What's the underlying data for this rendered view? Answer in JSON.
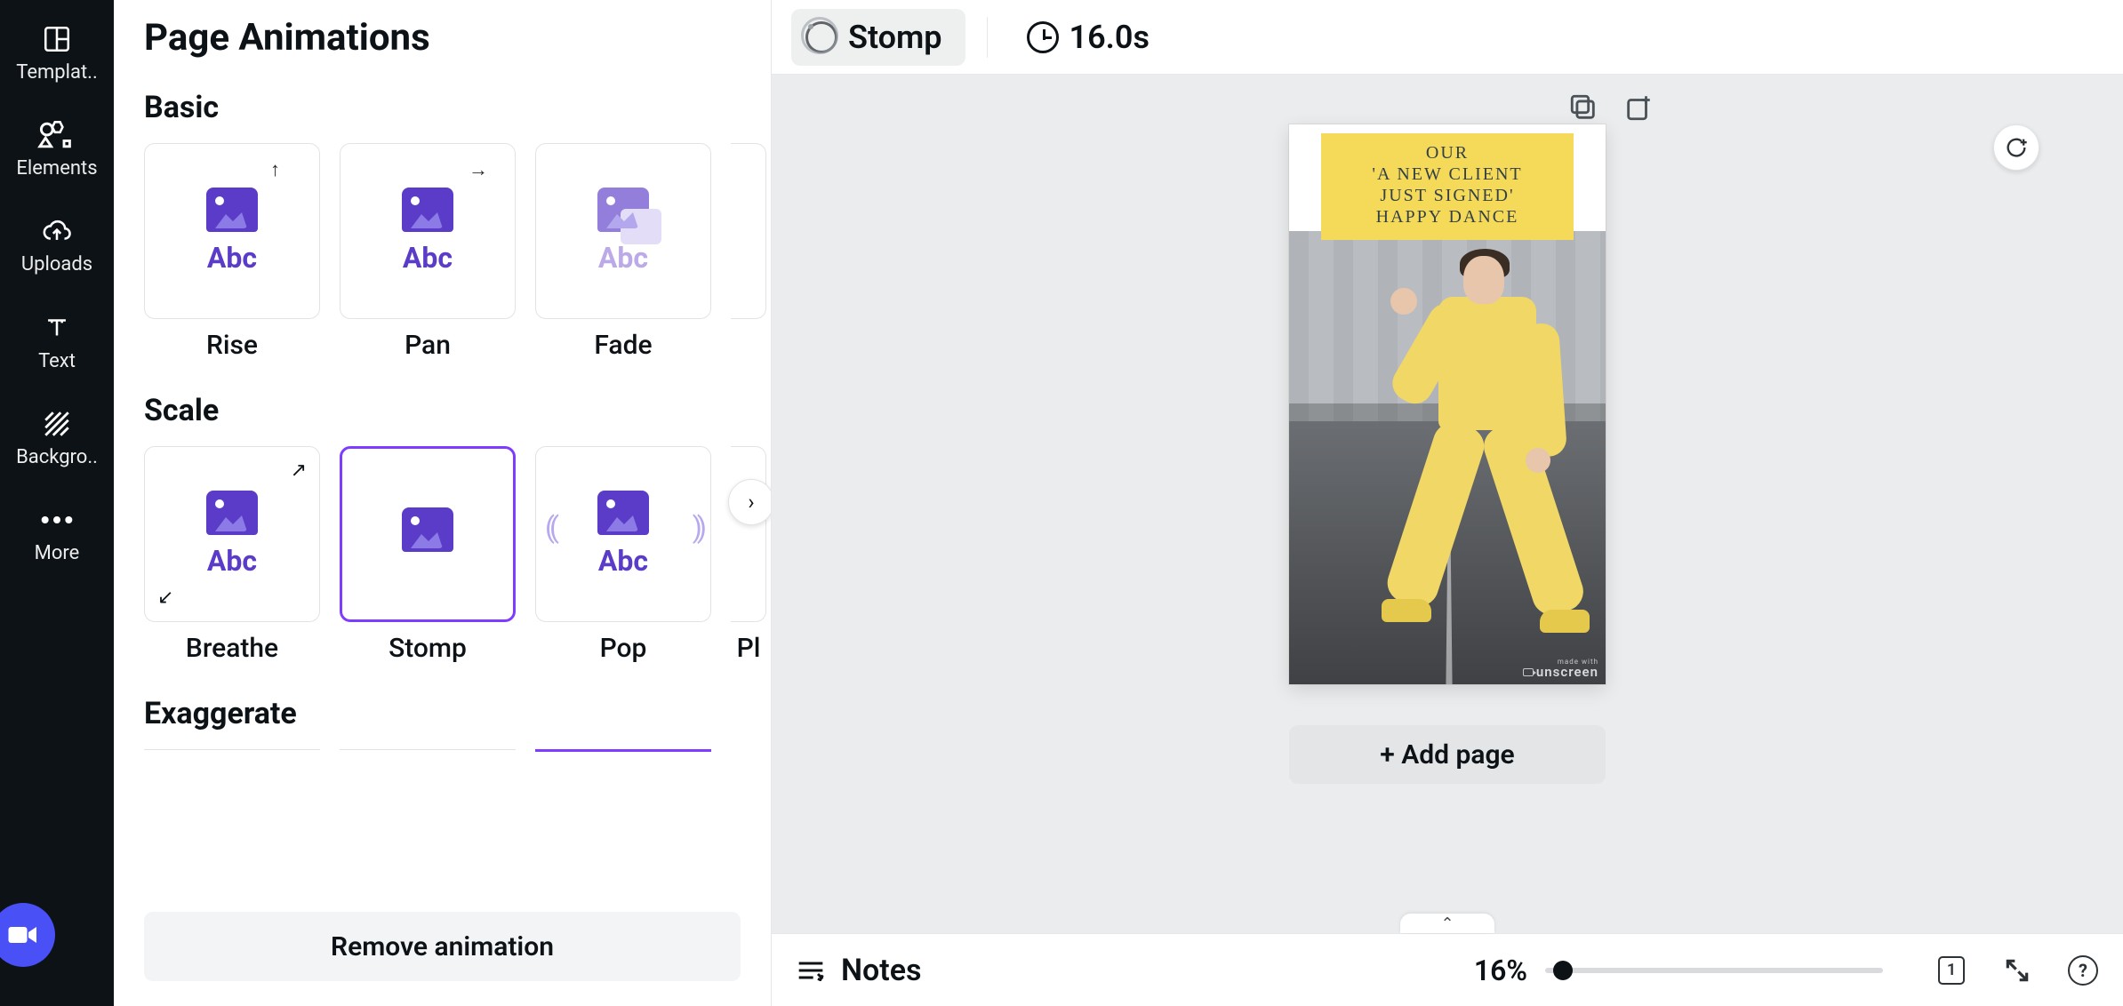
{
  "nav": {
    "items": [
      {
        "label": "Templat.."
      },
      {
        "label": "Elements"
      },
      {
        "label": "Uploads"
      },
      {
        "label": "Text"
      },
      {
        "label": "Backgro.."
      },
      {
        "label": "More"
      }
    ]
  },
  "panel": {
    "title": "Page Animations",
    "sections": {
      "basic": {
        "title": "Basic",
        "tiles": [
          {
            "label": "Rise"
          },
          {
            "label": "Pan"
          },
          {
            "label": "Fade"
          }
        ]
      },
      "scale": {
        "title": "Scale",
        "tiles": [
          {
            "label": "Breathe"
          },
          {
            "label": "Stomp"
          },
          {
            "label": "Pop"
          },
          {
            "label_partial": "Pl"
          }
        ]
      },
      "exaggerate": {
        "title": "Exaggerate"
      }
    },
    "remove_label": "Remove animation",
    "abc": "Abc"
  },
  "toolbar": {
    "animation_name": "Stomp",
    "duration": "16.0s"
  },
  "design": {
    "text_lines": "OUR\n'A NEW CLIENT\nJUST SIGNED'\nHAPPY DANCE",
    "watermark_small": "made with",
    "watermark": "unscreen"
  },
  "add_page_label": "+ Add page",
  "bottombar": {
    "notes": "Notes",
    "zoom": "16%",
    "page_number": "1",
    "help": "?"
  }
}
